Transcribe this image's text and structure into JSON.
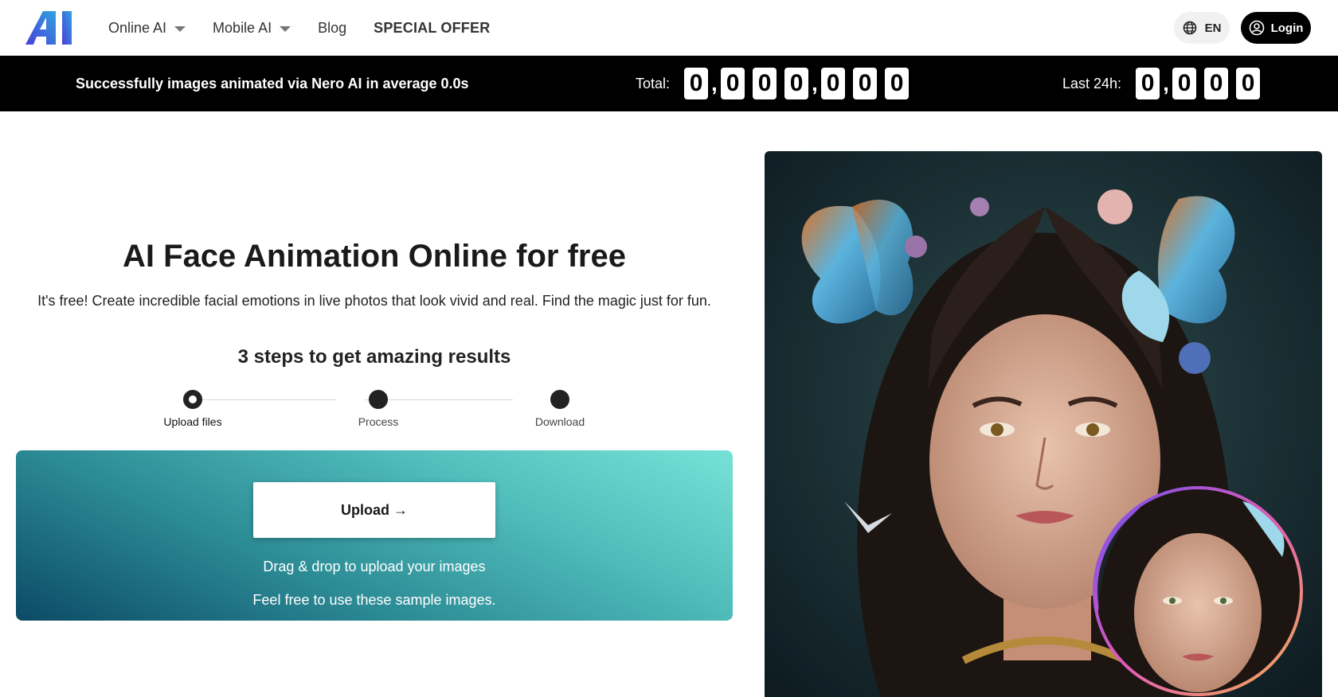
{
  "header": {
    "logo_text": "AI",
    "nav": [
      {
        "label": "Online AI",
        "dropdown": true
      },
      {
        "label": "Mobile AI",
        "dropdown": true
      },
      {
        "label": "Blog",
        "dropdown": false
      },
      {
        "label": "SPECIAL OFFER",
        "dropdown": false
      }
    ],
    "language": "EN",
    "login_label": "Login"
  },
  "stats": {
    "message": "Successfully images animated via Nero AI in average 0.0s",
    "total_label": "Total:",
    "total_digits": [
      "0",
      ",",
      "0",
      "0",
      "0",
      ",",
      "0",
      "0",
      "0"
    ],
    "last24_label": "Last 24h:",
    "last24_digits": [
      "0",
      ",",
      "0",
      "0",
      "0"
    ]
  },
  "hero": {
    "title": "AI Face Animation Online for free",
    "subtitle": "It's free! Create incredible facial emotions in live photos that look vivid and real. Find the magic just for fun."
  },
  "steps": {
    "title": "3 steps to get amazing results",
    "items": [
      {
        "label": "Upload files",
        "active": true
      },
      {
        "label": "Process",
        "active": false
      },
      {
        "label": "Download",
        "active": false
      }
    ]
  },
  "upload": {
    "button_label": "Upload →",
    "drag_hint": "Drag & drop to upload your images",
    "sample_hint": "Feel free to use these sample images."
  },
  "colors": {
    "stats_bar_bg": "#000000",
    "upload_gradient_start": "#0c4a66",
    "upload_gradient_end": "#76e2d6",
    "logo_gradient_start": "#4a3fd8",
    "logo_gradient_end": "#2fa3e0"
  },
  "icons": {
    "language": "globe-icon",
    "login": "user-circle-icon",
    "dropdown": "caret-down-icon"
  }
}
